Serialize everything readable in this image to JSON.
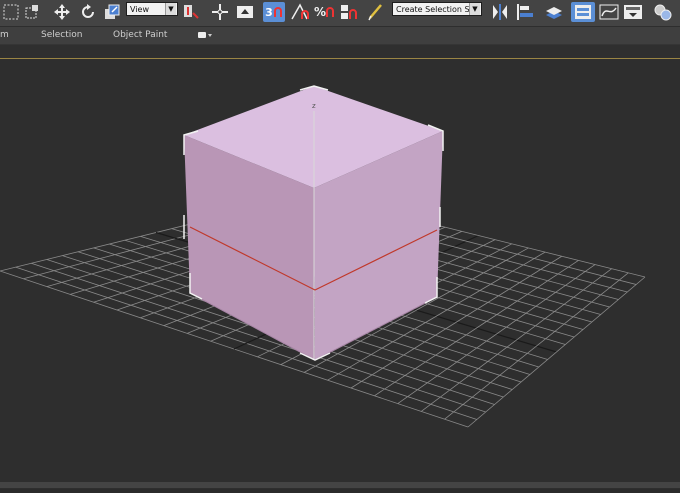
{
  "toolbar": {
    "reference_coordinate": "View",
    "named_selection_set": "Create Selection Se",
    "snap_label": "3"
  },
  "ribbon": {
    "tabs": [
      "m",
      "Selection",
      "Object Paint"
    ]
  },
  "viewport": {
    "axis_label": "z",
    "colors": {
      "background": "#2e2e2e",
      "grid": "#8a8a8a",
      "cube_top": "#dcbfe0",
      "cube_left": "#b995b6",
      "cube_right": "#c5a6c6",
      "section_line": "#c0392b",
      "active_border": "#9a8544"
    }
  }
}
